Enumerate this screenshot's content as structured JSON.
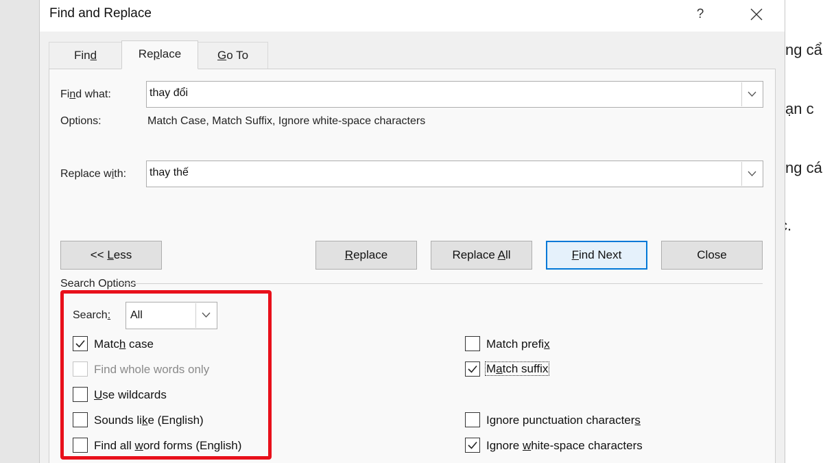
{
  "dialog": {
    "title": "Find and Replace",
    "help_label": "?",
    "tabs": [
      {
        "name": "find",
        "pre": "Fin",
        "key": "d",
        "post": ""
      },
      {
        "name": "replace",
        "pre": "Re",
        "key": "p",
        "post": "lace"
      },
      {
        "name": "goto",
        "pre": "",
        "key": "G",
        "post": "o To"
      }
    ],
    "find_what": {
      "label_pre": "Fi",
      "label_key": "n",
      "label_post": "d what:",
      "value": "thay đổi"
    },
    "options": {
      "label": "Options:",
      "value": "Match Case, Match Suffix, Ignore white-space characters"
    },
    "replace_with": {
      "label_pre": "Replace w",
      "label_key": "i",
      "label_post": "th:",
      "value": "thay thế"
    },
    "buttons": {
      "less": {
        "pre": "<< ",
        "key": "L",
        "post": "ess"
      },
      "replace": {
        "pre": "",
        "key": "R",
        "post": "eplace"
      },
      "replace_all": {
        "pre": "Replace ",
        "key": "A",
        "post": "ll"
      },
      "find_next": {
        "pre": "",
        "key": "F",
        "post": "ind Next"
      },
      "close": {
        "label": "Close"
      }
    },
    "search_options": {
      "heading": "Search Options",
      "search_label_pre": "Search",
      "search_label_key": ":",
      "search_value": "All",
      "left": [
        {
          "name": "match-case",
          "pre": "Matc",
          "key": "h",
          "post": " case",
          "checked": true,
          "disabled": false
        },
        {
          "name": "find-whole-words",
          "pre": "Find whole words only",
          "key": "",
          "post": "",
          "checked": false,
          "disabled": true
        },
        {
          "name": "use-wildcards",
          "pre": "",
          "key": "U",
          "post": "se wildcards",
          "checked": false,
          "disabled": false
        },
        {
          "name": "sounds-like",
          "pre": "Sounds li",
          "key": "k",
          "post": "e (English)",
          "checked": false,
          "disabled": false
        },
        {
          "name": "find-all-word-forms",
          "pre": "Find all ",
          "key": "w",
          "post": "ord forms (English)",
          "checked": false,
          "disabled": false
        }
      ],
      "right": [
        {
          "name": "match-prefix",
          "pre": "Match prefi",
          "key": "x",
          "post": "",
          "checked": false
        },
        {
          "name": "match-suffix",
          "pre": "M",
          "key": "a",
          "post": "tch suffix",
          "checked": true
        },
        {
          "name": "ignore-punctuation",
          "pre": "Ignore punctuation character",
          "key": "s",
          "post": "",
          "checked": false
        },
        {
          "name": "ignore-whitespace",
          "pre": "Ignore ",
          "key": "w",
          "post": "hite-space characters",
          "checked": true
        }
      ]
    }
  },
  "background_doc": {
    "lines": [
      "ng cẩ",
      "ạn c",
      "ng cá",
      "c."
    ]
  },
  "colors": {
    "highlight_box": "#e8101b",
    "primary_border": "#0078d7"
  }
}
